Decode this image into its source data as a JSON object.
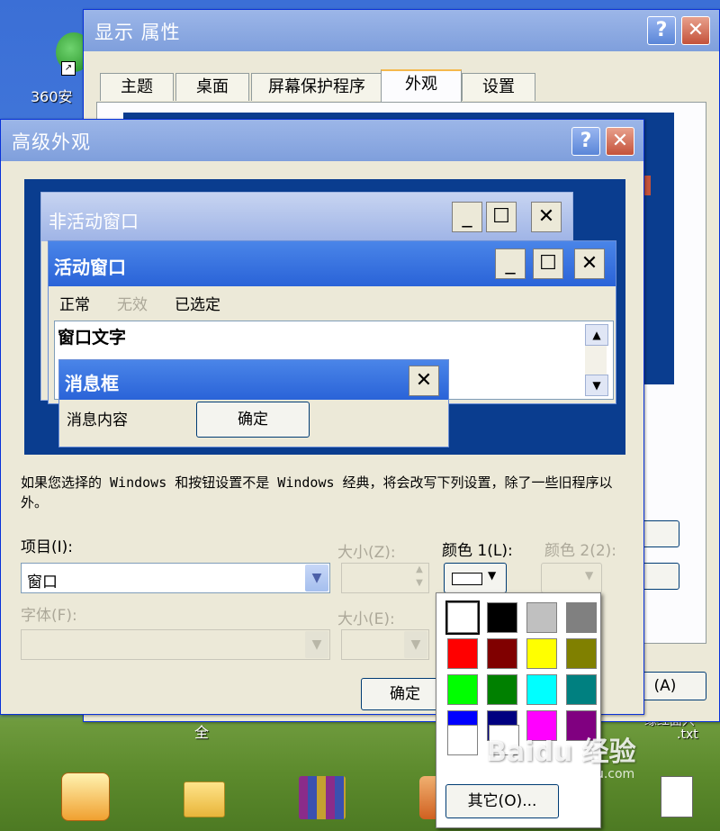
{
  "desktop": {
    "icon_360_label": "360安",
    "icon_360_label2": "全",
    "icon_txt_label": "缘红面兴",
    "icon_txt_label2": ".txt",
    "taskbar_icons": [
      "pps-icon",
      "folder-icon",
      "winrar-icon",
      "app-icon",
      "document-icon"
    ]
  },
  "display_properties": {
    "title": "显示 属性",
    "tabs": [
      "主题",
      "桌面",
      "屏幕保护程序",
      "外观",
      "设置"
    ],
    "active_tab": "外观",
    "partial_button_label": "(A)"
  },
  "advanced_appearance": {
    "title": "高级外观",
    "preview": {
      "inactive_window_title": "非活动窗口",
      "active_window_title": "活动窗口",
      "menu_items": [
        "正常",
        "无效",
        "已选定"
      ],
      "window_text": "窗口文字",
      "message_box_title": "消息框",
      "message_box_content": "消息内容",
      "message_box_ok": "确定"
    },
    "note": "如果您选择的 Windows 和按钮设置不是 Windows 经典，将会改写下列设置，除了一些旧程序以外。",
    "item_label": "项目(I):",
    "item_value": "窗口",
    "size_label": "大小(Z):",
    "color1_label": "颜色 1(L):",
    "color2_label": "颜色 2(2):",
    "font_label": "字体(F):",
    "font_size_label": "大小(E):",
    "ok_button": "确定"
  },
  "color_picker": {
    "selected": "#ffffff",
    "colors": [
      "#ffffff",
      "#000000",
      "#c0c0c0",
      "#808080",
      "#ff0000",
      "#800000",
      "#ffff00",
      "#808000",
      "#00ff00",
      "#008000",
      "#00ffff",
      "#008080",
      "#0000ff",
      "#000080",
      "#ff00ff",
      "#800080"
    ],
    "other_button": "其它(O)..."
  },
  "watermark": "Baidu 经验",
  "watermark_url": "jingyan.baidu.com",
  "colors": {
    "xp_blue": "#0a246a",
    "title_active": "#2a63d8",
    "preview_bg": "#0a3d8f"
  }
}
